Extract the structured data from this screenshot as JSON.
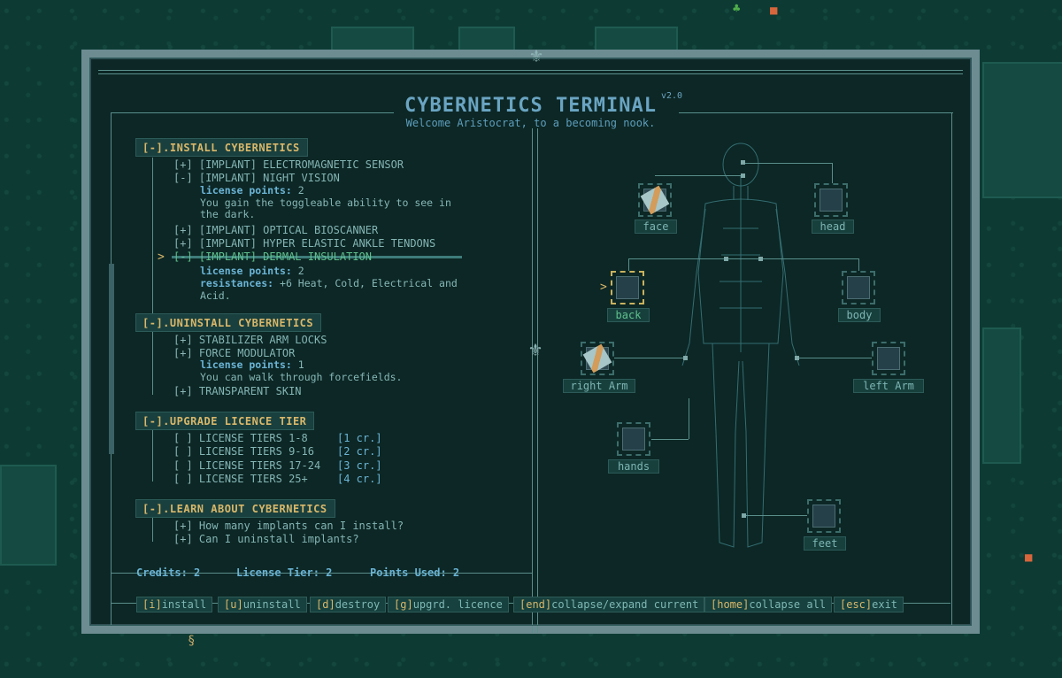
{
  "title": "CYBERNETICS TERMINAL",
  "version": "v2.0",
  "subtitle": "Welcome Aristocrat, to a becoming nook.",
  "sections": [
    {
      "header": "[-].INSTALL CYBERNETICS",
      "items": [
        {
          "bullet": "[+]",
          "text": "[IMPLANT] ELECTROMAGNETIC SENSOR"
        },
        {
          "bullet": "[-]",
          "text": "[IMPLANT] NIGHT VISION"
        },
        {
          "bullet": "[+]",
          "text": "[IMPLANT] OPTICAL BIOSCANNER"
        },
        {
          "bullet": "[+]",
          "text": "[IMPLANT] HYPER ELASTIC ANKLE TENDONS"
        },
        {
          "bullet": "[-]",
          "text": "[IMPLANT] DERMAL INSULATION"
        }
      ],
      "night_vision": {
        "lp_label": "license points:",
        "lp_value": "2",
        "desc1": "You gain the toggleable ability to see in",
        "desc2": "the dark."
      },
      "dermal": {
        "lp_label": "license points:",
        "lp_value": "2",
        "res_label": "resistances:",
        "res1": "+6 Heat, Cold, Electrical and",
        "res2": "Acid."
      }
    },
    {
      "header": "[-].UNINSTALL CYBERNETICS",
      "items": [
        {
          "bullet": "[+]",
          "text": "STABILIZER ARM LOCKS"
        },
        {
          "bullet": "[+]",
          "text": "FORCE MODULATOR"
        },
        {
          "bullet": "[+]",
          "text": "TRANSPARENT SKIN"
        }
      ],
      "force": {
        "lp_label": "license points:",
        "lp_value": "1",
        "desc": "You can walk through forcefields."
      }
    },
    {
      "header": "[-].UPGRADE LICENCE TIER",
      "items": [
        {
          "bullet": "[ ]",
          "text": "LICENSE TIERS 1-8",
          "cost": "[1 cr.]"
        },
        {
          "bullet": "[ ]",
          "text": "LICENSE TIERS 9-16",
          "cost": "[2 cr.]"
        },
        {
          "bullet": "[ ]",
          "text": "LICENSE TIERS 17-24",
          "cost": "[3 cr.]"
        },
        {
          "bullet": "[ ]",
          "text": "LICENSE TIERS 25+",
          "cost": "[4 cr.]"
        }
      ]
    },
    {
      "header": "[-].LEARN ABOUT CYBERNETICS",
      "items": [
        {
          "bullet": "[+]",
          "text": "How many implants can I install?"
        },
        {
          "bullet": "[+]",
          "text": "Can I uninstall implants?"
        }
      ]
    }
  ],
  "cursor": ">",
  "status": {
    "credits": "Credits: 2",
    "tier": "License Tier: 2",
    "points": "Points Used: 2"
  },
  "hotkeys": [
    {
      "key": "[i]",
      "label": "install"
    },
    {
      "key": "[u]",
      "label": "uninstall"
    },
    {
      "key": "[d]",
      "label": "destroy"
    },
    {
      "key": "[g]",
      "label": "upgrd. licence"
    },
    {
      "key": "[end]",
      "label": "collapse/expand current"
    },
    {
      "key": "[home]",
      "label": "collapse all"
    },
    {
      "key": "[esc]",
      "label": "exit"
    }
  ],
  "slots": {
    "face": "face",
    "head": "head",
    "back": "back",
    "body": "body",
    "right_arm": "right Arm",
    "left_arm": "left Arm",
    "hands": "hands",
    "feet": "feet"
  },
  "colors": {
    "header": "#d9b76a",
    "selected": "#5fc08d",
    "accent": "#6ab3d4",
    "frame": "#6d8c92"
  }
}
